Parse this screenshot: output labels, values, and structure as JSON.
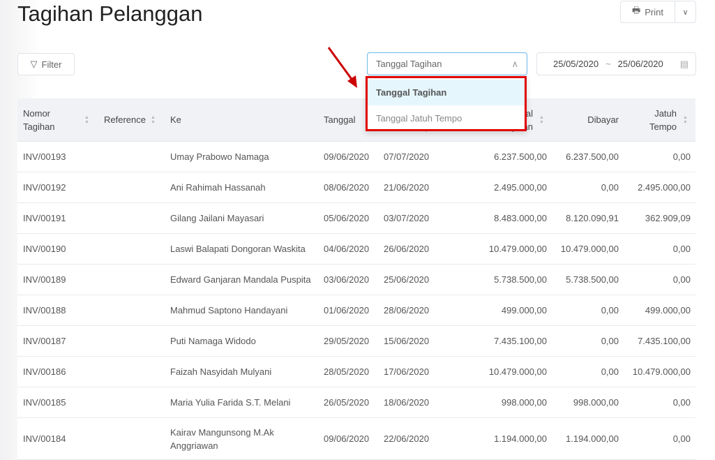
{
  "page": {
    "title": "Tagihan Pelanggan"
  },
  "toolbar": {
    "print_label": "Print",
    "filter_label": "Filter",
    "date_type_selected": "Tanggal Tagihan",
    "date_from": "25/05/2020",
    "date_sep": "~",
    "date_to": "25/06/2020"
  },
  "dropdown": {
    "options": [
      "Tanggal Tagihan",
      "Tanggal Jatuh Tempo"
    ],
    "selected": "Tanggal Tagihan"
  },
  "table": {
    "headers": {
      "nomor": "Nomor Tagihan",
      "reference": "Reference",
      "ke": "Ke",
      "tanggal": "Tanggal",
      "jatuh_tempo_date": "Tanggal Jatuh Tempo",
      "total": "Total Tagihan",
      "dibayar": "Dibayar",
      "jatuh_tempo": "Jatuh Tempo"
    },
    "rows": [
      {
        "nomor": "INV/00193",
        "reference": "",
        "ke": "Umay Prabowo Namaga",
        "tanggal": "09/06/2020",
        "jt": "07/07/2020",
        "total": "6.237.500,00",
        "dibayar": "6.237.500,00",
        "sisa": "0,00"
      },
      {
        "nomor": "INV/00192",
        "reference": "",
        "ke": "Ani Rahimah Hassanah",
        "tanggal": "08/06/2020",
        "jt": "21/06/2020",
        "total": "2.495.000,00",
        "dibayar": "0,00",
        "sisa": "2.495.000,00"
      },
      {
        "nomor": "INV/00191",
        "reference": "",
        "ke": "Gilang Jailani Mayasari",
        "tanggal": "05/06/2020",
        "jt": "03/07/2020",
        "total": "8.483.000,00",
        "dibayar": "8.120.090,91",
        "sisa": "362.909,09"
      },
      {
        "nomor": "INV/00190",
        "reference": "",
        "ke": "Laswi Balapati Dongoran Waskita",
        "tanggal": "04/06/2020",
        "jt": "26/06/2020",
        "total": "10.479.000,00",
        "dibayar": "10.479.000,00",
        "sisa": "0,00"
      },
      {
        "nomor": "INV/00189",
        "reference": "",
        "ke": "Edward Ganjaran Mandala Puspita",
        "tanggal": "03/06/2020",
        "jt": "25/06/2020",
        "total": "5.738.500,00",
        "dibayar": "5.738.500,00",
        "sisa": "0,00"
      },
      {
        "nomor": "INV/00188",
        "reference": "",
        "ke": "Mahmud Saptono Handayani",
        "tanggal": "01/06/2020",
        "jt": "28/06/2020",
        "total": "499.000,00",
        "dibayar": "0,00",
        "sisa": "499.000,00"
      },
      {
        "nomor": "INV/00187",
        "reference": "",
        "ke": "Puti Namaga Widodo",
        "tanggal": "29/05/2020",
        "jt": "15/06/2020",
        "total": "7.435.100,00",
        "dibayar": "0,00",
        "sisa": "7.435.100,00"
      },
      {
        "nomor": "INV/00186",
        "reference": "",
        "ke": "Faizah Nasyidah Mulyani",
        "tanggal": "28/05/2020",
        "jt": "17/06/2020",
        "total": "10.479.000,00",
        "dibayar": "0,00",
        "sisa": "10.479.000,00"
      },
      {
        "nomor": "INV/00185",
        "reference": "",
        "ke": "Maria Yulia Farida S.T. Melani",
        "tanggal": "26/05/2020",
        "jt": "18/06/2020",
        "total": "998.000,00",
        "dibayar": "998.000,00",
        "sisa": "0,00"
      },
      {
        "nomor": "INV/00184",
        "reference": "",
        "ke": "Kairav Mangunsong M.Ak Anggriawan",
        "tanggal": "09/06/2020",
        "jt": "22/06/2020",
        "total": "1.194.000,00",
        "dibayar": "1.194.000,00",
        "sisa": "0,00"
      }
    ]
  },
  "colors": {
    "highlight_border": "#e00000",
    "arrow": "#cc0000",
    "focus_border": "#6bb7ec",
    "selected_option_bg": "#e6f6fd"
  }
}
